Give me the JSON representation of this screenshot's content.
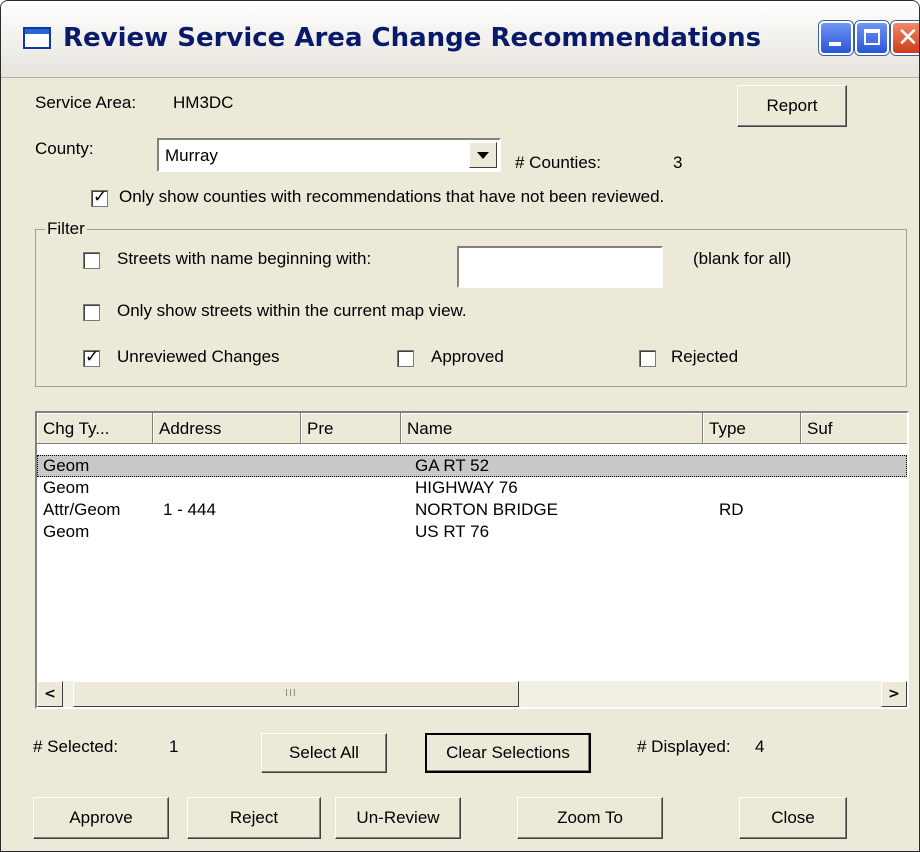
{
  "window": {
    "title": "Review Service Area Change Recommendations"
  },
  "service_area": {
    "label": "Service Area:",
    "value": "HM3DC"
  },
  "report_button": "Report",
  "county": {
    "label": "County:",
    "value": "Murray",
    "count_label": "# Counties:",
    "count": "3"
  },
  "only_unreviewed": {
    "label": "Only show counties with recommendations that have not been reviewed.",
    "checked": true
  },
  "filter": {
    "legend": "Filter",
    "street_name": {
      "label": "Streets with name beginning with:",
      "value": "",
      "hint": "(blank for all)",
      "checked": false
    },
    "map_view": {
      "label": "Only show streets within the current map view.",
      "checked": false
    },
    "unreviewed": {
      "label": "Unreviewed Changes",
      "checked": true
    },
    "approved": {
      "label": "Approved",
      "checked": false
    },
    "rejected": {
      "label": "Rejected",
      "checked": false
    }
  },
  "list": {
    "columns": [
      "Chg Ty...",
      "Address",
      "Pre",
      "Name",
      "Type",
      "Suf"
    ],
    "rows": [
      {
        "chg_type": "Geom",
        "address": "",
        "pre": "",
        "name": "GA RT 52",
        "type": "",
        "suf": "",
        "selected": true
      },
      {
        "chg_type": "Geom",
        "address": "",
        "pre": "",
        "name": "HIGHWAY 76",
        "type": "",
        "suf": "",
        "selected": false
      },
      {
        "chg_type": "Attr/Geom",
        "address": "1 - 444",
        "pre": "",
        "name": "NORTON BRIDGE",
        "type": "RD",
        "suf": "",
        "selected": false
      },
      {
        "chg_type": "Geom",
        "address": "",
        "pre": "",
        "name": "US RT 76",
        "type": "",
        "suf": "",
        "selected": false
      }
    ]
  },
  "selected": {
    "label": "# Selected:",
    "value": "1"
  },
  "displayed": {
    "label": "# Displayed:",
    "value": "4"
  },
  "buttons": {
    "select_all": "Select All",
    "clear_selections": "Clear Selections",
    "approve": "Approve",
    "reject": "Reject",
    "unreview": "Un-Review",
    "zoom_to": "Zoom To",
    "close": "Close"
  }
}
